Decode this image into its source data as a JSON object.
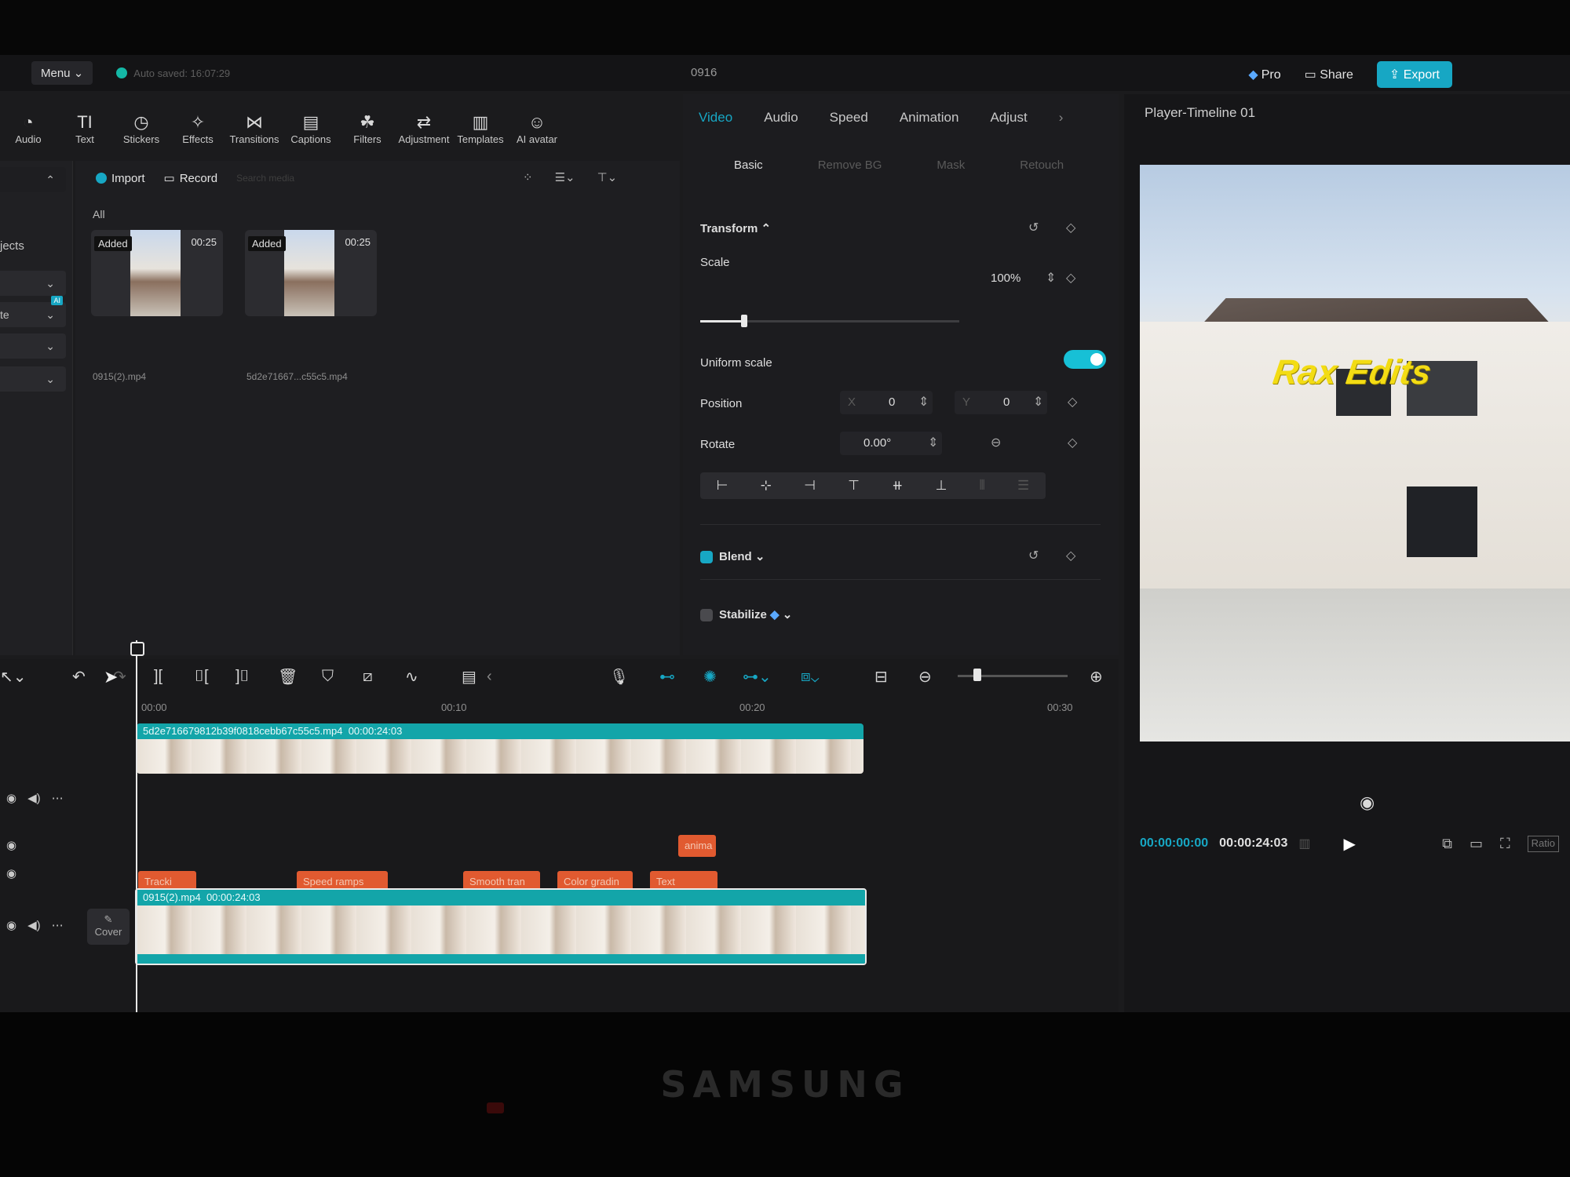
{
  "topbar": {
    "menu": "Menu",
    "autosave": "Auto saved: 16:07:29",
    "project_title": "0916",
    "pro": "Pro",
    "share": "Share",
    "export": "Export"
  },
  "tools": [
    {
      "label": "Audio",
      "icon": "audio-icon"
    },
    {
      "label": "Text",
      "icon": "text-icon"
    },
    {
      "label": "Stickers",
      "icon": "stickers-icon"
    },
    {
      "label": "Effects",
      "icon": "effects-icon"
    },
    {
      "label": "Transitions",
      "icon": "transitions-icon"
    },
    {
      "label": "Captions",
      "icon": "captions-icon"
    },
    {
      "label": "Filters",
      "icon": "filters-icon"
    },
    {
      "label": "Adjustment",
      "icon": "adjustment-icon"
    },
    {
      "label": "Templates",
      "icon": "templates-icon"
    },
    {
      "label": "AI avatar",
      "icon": "ai-avatar-icon"
    }
  ],
  "sidebar": {
    "projects_label": "jects",
    "ai_badge": "AI",
    "item_te": "te"
  },
  "media": {
    "import": "Import",
    "record": "Record",
    "search_placeholder": "Search media",
    "all": "All",
    "items": [
      {
        "badge": "Added",
        "duration": "00:25",
        "name": "0915(2).mp4"
      },
      {
        "badge": "Added",
        "duration": "00:25",
        "name": "5d2e71667...c55c5.mp4"
      }
    ]
  },
  "properties": {
    "tabs": [
      "Video",
      "Audio",
      "Speed",
      "Animation",
      "Adjust"
    ],
    "active_tab": "Video",
    "subtabs": [
      "Basic",
      "Remove BG",
      "Mask",
      "Retouch"
    ],
    "active_subtab": "Basic",
    "transform": "Transform",
    "scale_label": "Scale",
    "scale_value": "100%",
    "scale_fraction": 0.17,
    "uniform_scale": "Uniform scale",
    "uniform_scale_on": true,
    "position_label": "Position",
    "pos_x_label": "X",
    "pos_x": "0",
    "pos_y_label": "Y",
    "pos_y": "0",
    "rotate_label": "Rotate",
    "rotate_value": "0.00°",
    "blend": "Blend",
    "stabilize": "Stabilize"
  },
  "player": {
    "title": "Player-Timeline 01",
    "watermark": "Rax Edits",
    "current_time": "00:00:00:00",
    "total_time": "00:00:24:03",
    "ratio": "Ratio"
  },
  "timeline": {
    "ruler": [
      "00:00",
      "00:10",
      "00:20",
      "00:30"
    ],
    "clip_top": {
      "name": "5d2e716679812b39f0818cebb67c55c5.mp4",
      "duration": "00:00:24:03"
    },
    "clip_main": {
      "name": "0915(2).mp4",
      "duration": "00:00:24:03"
    },
    "anim_label": "anima",
    "effects": [
      "Tracki",
      "Speed ramps",
      "Smooth tran",
      "Color gradin",
      "Text"
    ],
    "cover": "Cover"
  },
  "colors": {
    "accent": "#17a7c4",
    "clip": "#13a5a9",
    "effect": "#e15a30",
    "brand_watermark": "#f3dc14"
  }
}
